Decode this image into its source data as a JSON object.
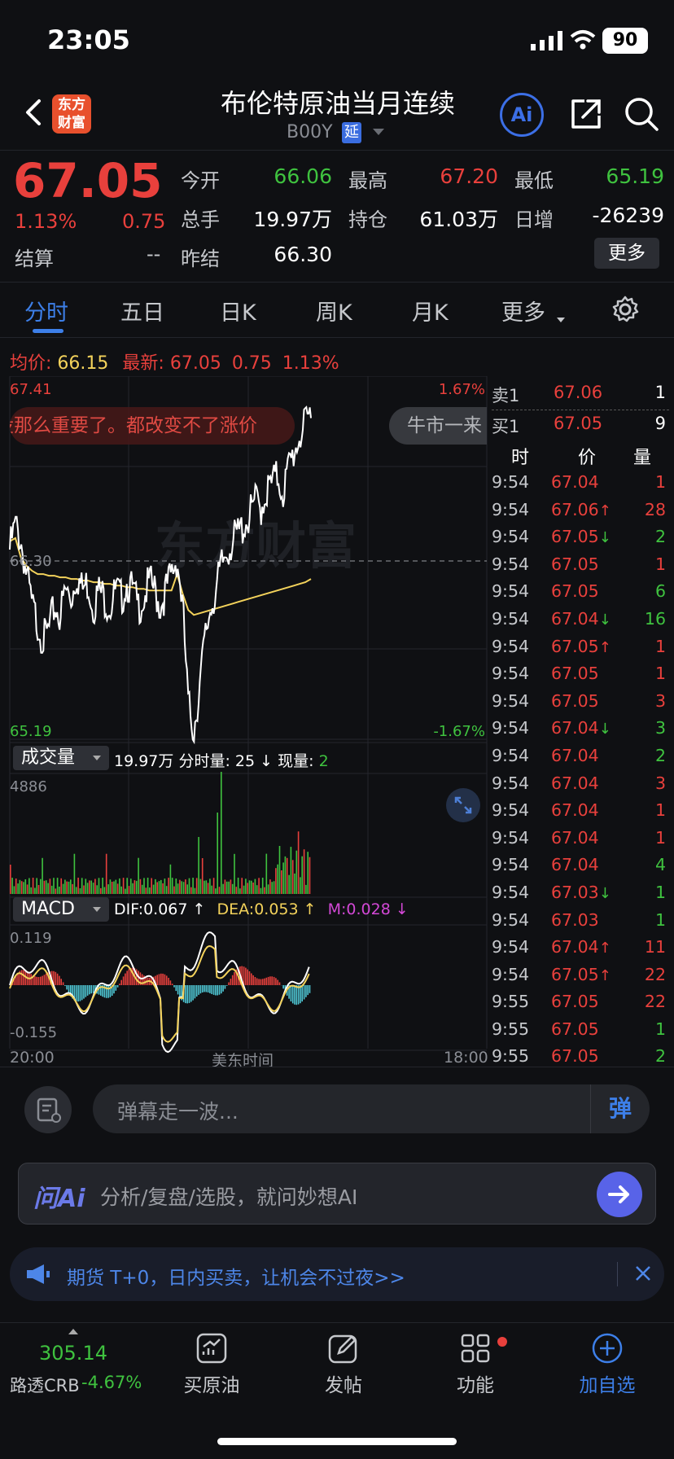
{
  "status_bar": {
    "time": "23:05",
    "battery": "90"
  },
  "header": {
    "logo_line1": "东方",
    "logo_line2": "财富",
    "title": "布伦特原油当月连续",
    "code": "B00Y",
    "delay_badge": "延",
    "ai_label": "Ai"
  },
  "quote": {
    "price": "67.05",
    "pct": "1.13%",
    "change": "0.75",
    "settle_label": "结算",
    "settle_value": "--",
    "fields": [
      {
        "label": "今开",
        "value": "66.06",
        "color": "green"
      },
      {
        "label": "最高",
        "value": "67.20",
        "color": "red"
      },
      {
        "label": "最低",
        "value": "65.19",
        "color": "green"
      },
      {
        "label": "总手",
        "value": "19.97万",
        "color": "white"
      },
      {
        "label": "持仓",
        "value": "61.03万",
        "color": "white"
      },
      {
        "label": "日增",
        "value": "-26239",
        "color": "white"
      },
      {
        "label": "昨结",
        "value": "66.30",
        "color": "white"
      }
    ],
    "more_button": "更多"
  },
  "tabs": [
    "分时",
    "五日",
    "日K",
    "周K",
    "月K",
    "更多"
  ],
  "avg_row": {
    "avg_label": "均价:",
    "avg_value": "66.15",
    "latest_label": "最新:",
    "latest_price": "67.05",
    "latest_change": "0.75",
    "latest_pct": "1.13%"
  },
  "chart": {
    "top_price": "67.41",
    "top_pct": "1.67%",
    "mid_price": "66.30",
    "bottom_price": "65.19",
    "bottom_pct": "-1.67%",
    "watermark": "东方财富",
    "danmu_left": "没那么重要了。都改变不了涨价",
    "danmu_right": "牛市一来"
  },
  "chart_data": {
    "type": "line",
    "title": "",
    "xlabel": "美东时间",
    "x_range": [
      "20:00",
      "18:00"
    ],
    "ylim": [
      65.19,
      67.41
    ],
    "reference_close": 66.3,
    "series": [
      {
        "name": "",
        "color": "#ffffff",
        "values": [
          66.35,
          66.5,
          66.4,
          66.2,
          66.0,
          65.9,
          65.8,
          65.85,
          66.0,
          65.95,
          66.1,
          66.05,
          66.2,
          66.1,
          66.15,
          66.0,
          66.1,
          66.05,
          66.0,
          66.1,
          66.05,
          66.15,
          66.1,
          66.0,
          66.05,
          66.15,
          66.1,
          66.0,
          66.1,
          66.2,
          66.3,
          66.0,
          65.4,
          65.25,
          65.5,
          65.8,
          66.0,
          66.1,
          66.25,
          66.35,
          66.4,
          66.45,
          66.5,
          66.55,
          66.65,
          66.6,
          66.7,
          66.75,
          66.8,
          66.7,
          66.85,
          66.95,
          67.05,
          67.1,
          67.2
        ]
      },
      {
        "name": "",
        "color": "#f3d25b",
        "values": [
          66.4,
          66.42,
          66.3,
          66.25,
          66.22,
          66.2,
          66.2,
          66.19,
          66.19,
          66.18,
          66.18,
          66.17,
          66.17,
          66.16,
          66.16,
          66.15,
          66.15,
          66.14,
          66.14,
          66.13,
          66.13,
          66.12,
          66.12,
          66.11,
          66.11,
          66.1,
          66.1,
          66.1,
          66.1,
          66.1,
          66.2,
          66.08,
          65.98,
          65.95,
          65.96,
          65.97,
          65.98,
          65.99,
          66.0,
          66.01,
          66.02,
          66.03,
          66.04,
          66.05,
          66.06,
          66.07,
          66.08,
          66.09,
          66.1,
          66.11,
          66.12,
          66.13,
          66.14,
          66.15,
          66.17
        ]
      }
    ]
  },
  "volume": {
    "button": "成交量",
    "total": "19.97万",
    "interval_label": "分时量:",
    "interval_value": "25",
    "current_label": "现量:",
    "current_value": "2",
    "max": "4886"
  },
  "macd": {
    "button": "MACD",
    "dif": "DIF:0.067",
    "dea": "DEA:0.053",
    "m": "M:0.028",
    "top": "0.119",
    "bottom": "-0.155"
  },
  "axis": {
    "left": "20:00",
    "mid": "美东时间",
    "right": "18:00"
  },
  "order_book": [
    {
      "label": "卖1",
      "price": "67.06",
      "qty": "1"
    },
    {
      "label": "买1",
      "price": "67.05",
      "qty": "9"
    }
  ],
  "ticks_header": {
    "time": "时",
    "price": "价",
    "qty": "量"
  },
  "ticks": [
    {
      "time": "9:54",
      "price": "67.04",
      "arrow": "",
      "qty": "1",
      "qty_color": "red"
    },
    {
      "time": "9:54",
      "price": "67.06",
      "arrow": "↑",
      "qty": "28",
      "qty_color": "red"
    },
    {
      "time": "9:54",
      "price": "67.05",
      "arrow": "↓",
      "qty": "2",
      "qty_color": "green"
    },
    {
      "time": "9:54",
      "price": "67.05",
      "arrow": "",
      "qty": "1",
      "qty_color": "red"
    },
    {
      "time": "9:54",
      "price": "67.05",
      "arrow": "",
      "qty": "6",
      "qty_color": "green"
    },
    {
      "time": "9:54",
      "price": "67.04",
      "arrow": "↓",
      "qty": "16",
      "qty_color": "green"
    },
    {
      "time": "9:54",
      "price": "67.05",
      "arrow": "↑",
      "qty": "1",
      "qty_color": "red"
    },
    {
      "time": "9:54",
      "price": "67.05",
      "arrow": "",
      "qty": "1",
      "qty_color": "red"
    },
    {
      "time": "9:54",
      "price": "67.05",
      "arrow": "",
      "qty": "3",
      "qty_color": "red"
    },
    {
      "time": "9:54",
      "price": "67.04",
      "arrow": "↓",
      "qty": "3",
      "qty_color": "green"
    },
    {
      "time": "9:54",
      "price": "67.04",
      "arrow": "",
      "qty": "2",
      "qty_color": "green"
    },
    {
      "time": "9:54",
      "price": "67.04",
      "arrow": "",
      "qty": "3",
      "qty_color": "red"
    },
    {
      "time": "9:54",
      "price": "67.04",
      "arrow": "",
      "qty": "1",
      "qty_color": "red"
    },
    {
      "time": "9:54",
      "price": "67.04",
      "arrow": "",
      "qty": "1",
      "qty_color": "red"
    },
    {
      "time": "9:54",
      "price": "67.04",
      "arrow": "",
      "qty": "4",
      "qty_color": "green"
    },
    {
      "time": "9:54",
      "price": "67.03",
      "arrow": "↓",
      "qty": "1",
      "qty_color": "green"
    },
    {
      "time": "9:54",
      "price": "67.03",
      "arrow": "",
      "qty": "1",
      "qty_color": "green"
    },
    {
      "time": "9:54",
      "price": "67.04",
      "arrow": "↑",
      "qty": "11",
      "qty_color": "red"
    },
    {
      "time": "9:54",
      "price": "67.05",
      "arrow": "↑",
      "qty": "22",
      "qty_color": "red"
    },
    {
      "time": "9:55",
      "price": "67.05",
      "arrow": "",
      "qty": "22",
      "qty_color": "red"
    },
    {
      "time": "9:55",
      "price": "67.05",
      "arrow": "",
      "qty": "1",
      "qty_color": "green"
    },
    {
      "time": "9:55",
      "price": "67.05",
      "arrow": "",
      "qty": "2",
      "qty_color": "green"
    }
  ],
  "comment": {
    "placeholder": "弹幕走一波...",
    "send": "弹"
  },
  "ai_bar": {
    "logo": "问Ai",
    "prompt": "分析/复盘/选股，就问妙想AI"
  },
  "notice": {
    "text": "期货 T+0，日内买卖，让机会不过夜>>"
  },
  "bottom_nav": {
    "index_value": "305.14",
    "index_label": "路透CRB",
    "index_pct": "-4.67%",
    "items": [
      "买原油",
      "发帖",
      "功能",
      "加自选"
    ]
  }
}
